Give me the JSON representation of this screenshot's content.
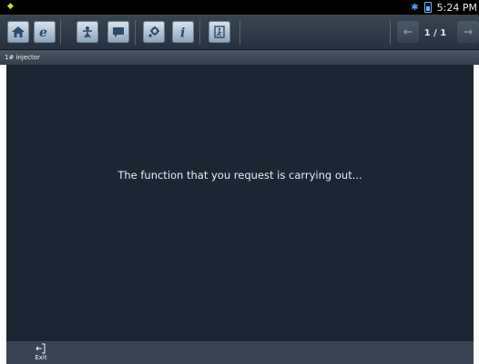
{
  "status_bar": {
    "time": "5:24 PM"
  },
  "toolbar": {
    "buttons": [
      "home-icon",
      "browser-icon",
      "diagnose-icon",
      "message-icon",
      "settings-icon",
      "info-icon",
      "exit-app-icon"
    ],
    "page_indicator": "1 / 1"
  },
  "breadcrumb": {
    "text": "1# injector"
  },
  "content": {
    "message": "The function that you request is carrying out..."
  },
  "bottom_bar": {
    "exit_label": "Exit"
  },
  "colors": {
    "content_bg": "#1b2633",
    "toolbar_bg": "#2e3945",
    "accent_button": "#b4c6d8"
  }
}
